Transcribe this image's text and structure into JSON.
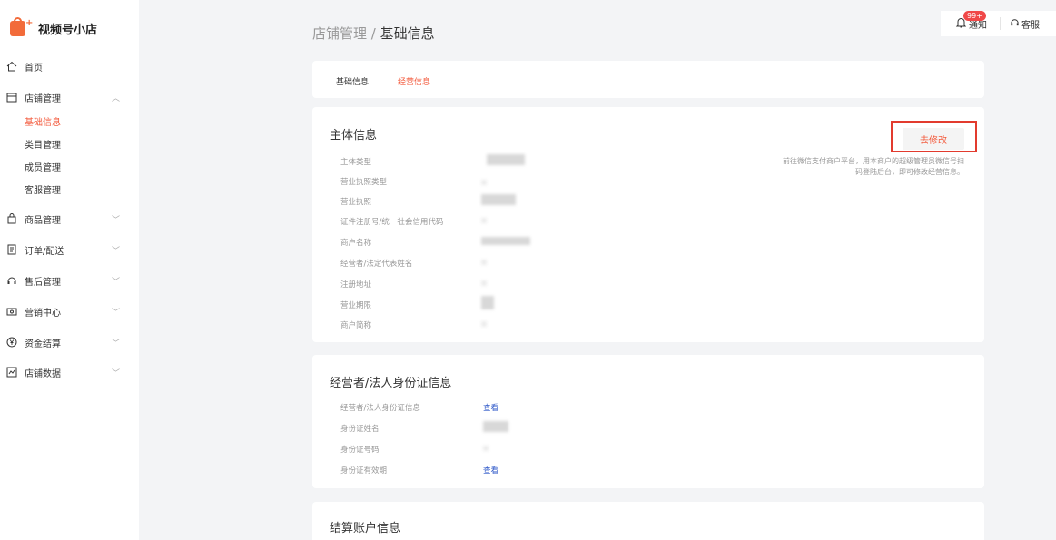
{
  "brand": {
    "name": "视频号小店"
  },
  "nav": {
    "home": "首页",
    "store": "店铺管理",
    "store_sub": [
      "基础信息",
      "类目管理",
      "成员管理",
      "客服管理"
    ],
    "goods": "商品管理",
    "orders": "订单/配送",
    "aftersale": "售后管理",
    "marketing": "营销中心",
    "finance": "资金结算",
    "data": "店铺数据"
  },
  "breadcrumb": {
    "parent": "店铺管理",
    "separator": " / ",
    "current": "基础信息"
  },
  "topbar": {
    "notify_label": "通知",
    "notify_badge": "99+",
    "service_label": "客服"
  },
  "tabs": [
    "基础信息",
    "经营信息"
  ],
  "main_info": {
    "title": "主体信息",
    "edit_button": "去修改",
    "hint": "前往微信支付商户平台，用本商户的超级管理员微信号扫码登陆后台，即可修改经营信息。",
    "fields": [
      "主体类型",
      "营业执照类型",
      "营业执照",
      "证件注册号/统一社会信用代码",
      "商户名称",
      "经营者/法定代表姓名",
      "注册地址",
      "营业期限",
      "商户简称"
    ]
  },
  "id_info": {
    "title": "经营者/法人身份证信息",
    "fields": [
      "经营者/法人身份证信息",
      "身份证姓名",
      "身份证号码",
      "身份证有效期"
    ],
    "view_link": "查看"
  },
  "settle_info": {
    "title": "结算账户信息"
  },
  "colors": {
    "accent": "#f35a3c",
    "link": "#2d57c8",
    "highlight": "#e23b2e"
  }
}
